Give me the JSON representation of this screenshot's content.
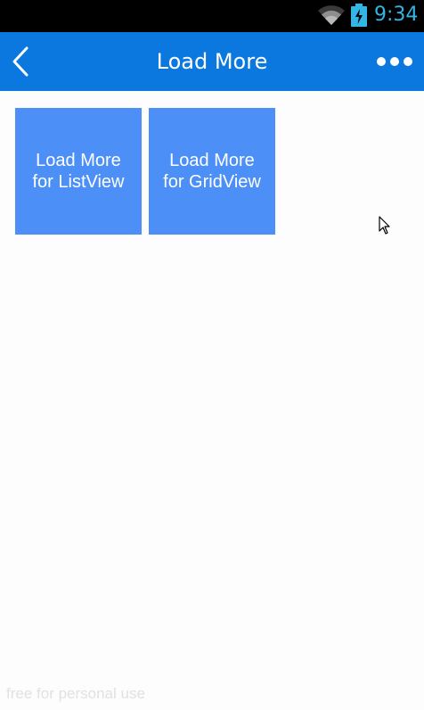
{
  "status_bar": {
    "time": "9:34",
    "wifi_icon": "wifi-icon",
    "battery_icon": "battery-charging-icon"
  },
  "app_bar": {
    "title": "Load More",
    "back_icon": "back-chevron-icon",
    "more_icon": "more-dots-icon",
    "color": "#0a78df"
  },
  "tiles": [
    {
      "label": "Load More\nfor ListView"
    },
    {
      "label": "Load More\nfor GridView"
    }
  ],
  "tile_color": "#4b8ff7",
  "watermark": "free for personal use"
}
